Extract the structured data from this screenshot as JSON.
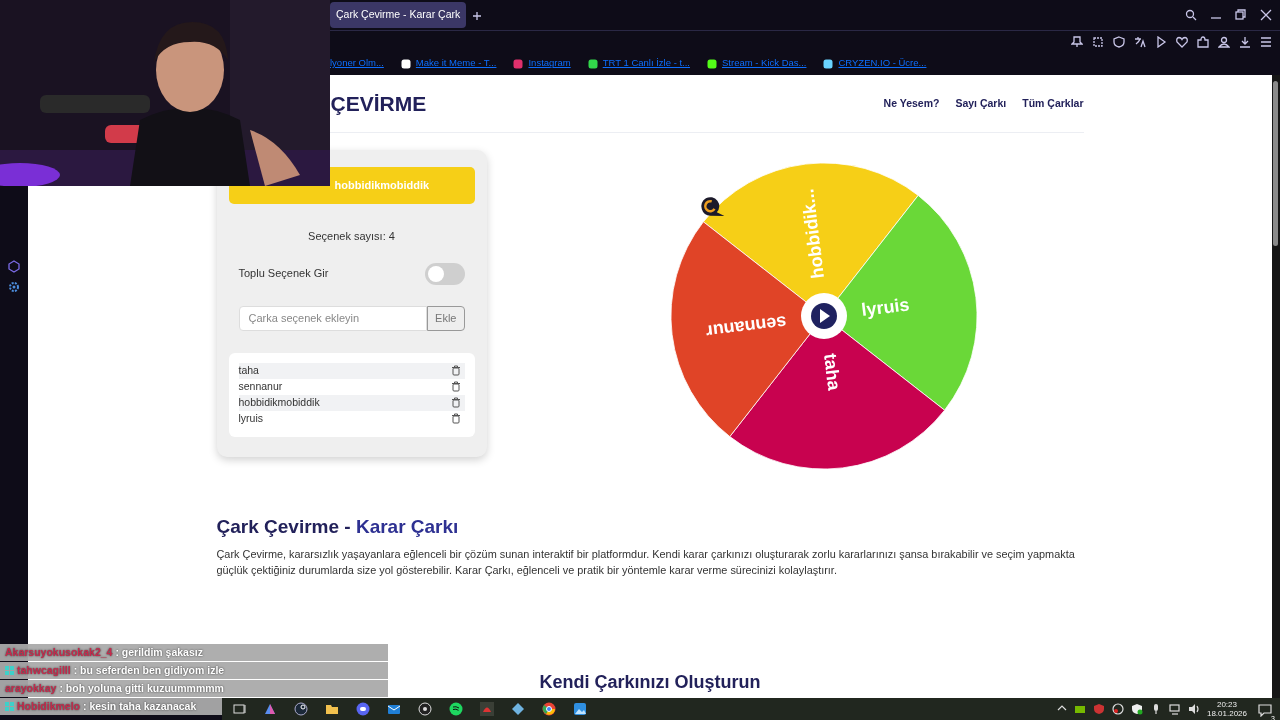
{
  "browser": {
    "tab_title": "Çark Çevirme - Karar Çark",
    "bookmarks": [
      {
        "label": "lyoner Olm...",
        "icon": false
      },
      {
        "label": "Make it Meme - T...",
        "icon": true
      },
      {
        "label": "Instagram",
        "icon": true
      },
      {
        "label": "TRT 1 Canlı İzle - t...",
        "icon": true
      },
      {
        "label": "Stream - Kick Das...",
        "icon": true
      },
      {
        "label": "CRYZEN.IO - Ücre...",
        "icon": true
      }
    ]
  },
  "site": {
    "logo": "ÇEVİRME",
    "nav": [
      "Ne Yesem?",
      "Sayı Çarkı",
      "Tüm Çarklar"
    ]
  },
  "panel": {
    "winner": "hobbidikmobiddik",
    "count": "Seçenek sayısı: 4",
    "bulk_toggle": {
      "label": "Toplu Seçenek Gir",
      "on": false
    },
    "input": {
      "placeholder": "Çarka seçenek ekleyin"
    },
    "add_button": "Ekle",
    "options": [
      "taha",
      "sennanur",
      "hobbidikmobiddik",
      "lyruis"
    ]
  },
  "wheel": {
    "segments": [
      {
        "label": "hobbidik...",
        "color": "#f6cf17"
      },
      {
        "label": "lyruis",
        "color": "#6ad838"
      },
      {
        "label": "taha",
        "color": "#c8024f"
      },
      {
        "label": "sennanur",
        "color": "#e04427"
      }
    ]
  },
  "article": {
    "title": "Çark Çevirme -",
    "title_accent": "Karar Çarkı",
    "text": "Çark Çevirme, kararsızlık yaşayanlara eğlenceli bir çözüm sunan interaktif bir platformdur. Kendi karar çarkınızı oluşturarak zorlu kararlarınızı şansa bırakabilir ve seçim yapmakta güçlük çektiğiniz durumlarda size yol gösterebilir. Karar Çarkı, eğlenceli ve pratik bir yöntemle karar verme sürecinizi kolaylaştırır.",
    "section_title": "Kendi Çarkınızı Oluşturun"
  },
  "chat": [
    {
      "user": "Akarsuyokusokak2_4",
      "message": ": gerildim şakasız",
      "badge": false
    },
    {
      "user": "tahwcagilll",
      "message": ": bu seferden ben gidiyom izle",
      "badge": true
    },
    {
      "user": "arayokkay",
      "message": ": boh yoluna gitti kuzuummmmm",
      "badge": false
    },
    {
      "user": "Hobidikmelo",
      "message": ": kesin taha kazanacak",
      "badge": true
    }
  ],
  "taskbar": {
    "time": "20:23",
    "date": "18.01.2026",
    "notifications": "3"
  }
}
